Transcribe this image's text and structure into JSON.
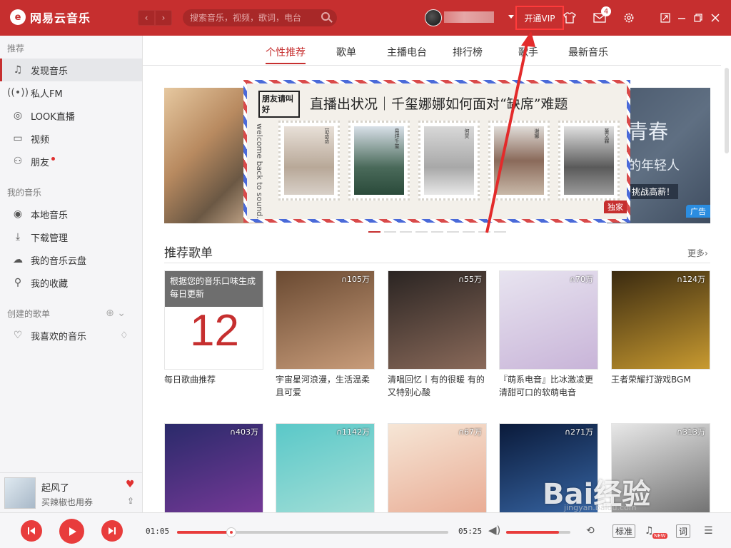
{
  "app": {
    "logo_mark": "e",
    "logo_text": "网易云音乐"
  },
  "topbar": {
    "back": "‹",
    "forward": "›",
    "search_placeholder": "搜索音乐，视频，歌词，电台",
    "vip_label": "开通VIP",
    "message_count": "4"
  },
  "sidebar": {
    "section_recommend": "推荐",
    "recommend_items": [
      {
        "label": "发现音乐",
        "icon": "music-note-icon"
      },
      {
        "label": "私人FM",
        "icon": "radio-icon"
      },
      {
        "label": "LOOK直播",
        "icon": "live-icon"
      },
      {
        "label": "视频",
        "icon": "video-icon"
      },
      {
        "label": "朋友",
        "icon": "friends-icon"
      }
    ],
    "section_my_music": "我的音乐",
    "my_music_items": [
      {
        "label": "本地音乐",
        "icon": "disc-icon"
      },
      {
        "label": "下载管理",
        "icon": "download-icon"
      },
      {
        "label": "我的音乐云盘",
        "icon": "cloud-icon"
      },
      {
        "label": "我的收藏",
        "icon": "collection-icon"
      }
    ],
    "section_created": "创建的歌单",
    "created_items": [
      {
        "label": "我喜欢的音乐",
        "icon": "heart-icon"
      }
    ]
  },
  "now_playing": {
    "title": "起风了",
    "artist": "买辣椒也用券"
  },
  "tabs": [
    "个性推荐",
    "歌单",
    "主播电台",
    "排行榜",
    "歌手",
    "最新音乐"
  ],
  "banner": {
    "logo_text": "朋友请叫好",
    "title": "直播出状况｜千玺娜娜如何面对“缺席”难题",
    "side_text": "welcome back to sound.",
    "stamp_names": [
      "范丞丞",
      "易烊千玺",
      "何炅",
      "谢娜",
      "董又霖"
    ],
    "exclusive_badge": "独家",
    "right_title": "青春",
    "right_sub": "的年轻人",
    "right_cta": "挑战高薪！",
    "ad_badge": "广告"
  },
  "section": {
    "title": "推荐歌单",
    "more": "更多›"
  },
  "playlists": [
    {
      "title": "每日歌曲推荐",
      "daily_tip": "根据您的音乐口味生成每日更新",
      "day": "12",
      "colors": [
        "#ffffff",
        "#ffffff"
      ]
    },
    {
      "title": "宇宙星河浪漫，生活温柔且可爱",
      "plays": "105万",
      "colors": [
        "#6a4a32",
        "#c89c7a"
      ]
    },
    {
      "title": "清唱回忆丨有的很暖 有的又特别心酸",
      "plays": "55万",
      "colors": [
        "#2a2422",
        "#8a6a5a"
      ]
    },
    {
      "title": "『萌系电音』比冰激凌更清甜可口的软萌电音",
      "plays": "70万",
      "colors": [
        "#e8e4f0",
        "#c8b4d8"
      ]
    },
    {
      "title": "王者荣耀打游戏BGM",
      "plays": "124万",
      "colors": [
        "#3a2a10",
        "#c89a30"
      ]
    },
    {
      "title": "",
      "plays": "403万",
      "colors": [
        "#2a2a6a",
        "#7a3a9a"
      ]
    },
    {
      "title": "",
      "plays": "1142万",
      "colors": [
        "#5ac8c8",
        "#a8e0d8"
      ]
    },
    {
      "title": "",
      "plays": "67万",
      "colors": [
        "#f6e6d6",
        "#e8a890"
      ]
    },
    {
      "title": "",
      "plays": "271万",
      "colors": [
        "#0a1a3a",
        "#3a6aaa"
      ]
    },
    {
      "title": "",
      "plays": "313万",
      "colors": [
        "#e8e8e8",
        "#6a6a6a"
      ]
    }
  ],
  "player": {
    "current_time": "01:05",
    "total_time": "05:25",
    "progress": 0.2,
    "volume": 0.82,
    "quality": "标准",
    "lyric": "词",
    "new_badge": "NEW"
  },
  "watermark": {
    "text": "Bai经验",
    "sub": "jingyan.baidu.com"
  },
  "accent": "#c62f2f"
}
